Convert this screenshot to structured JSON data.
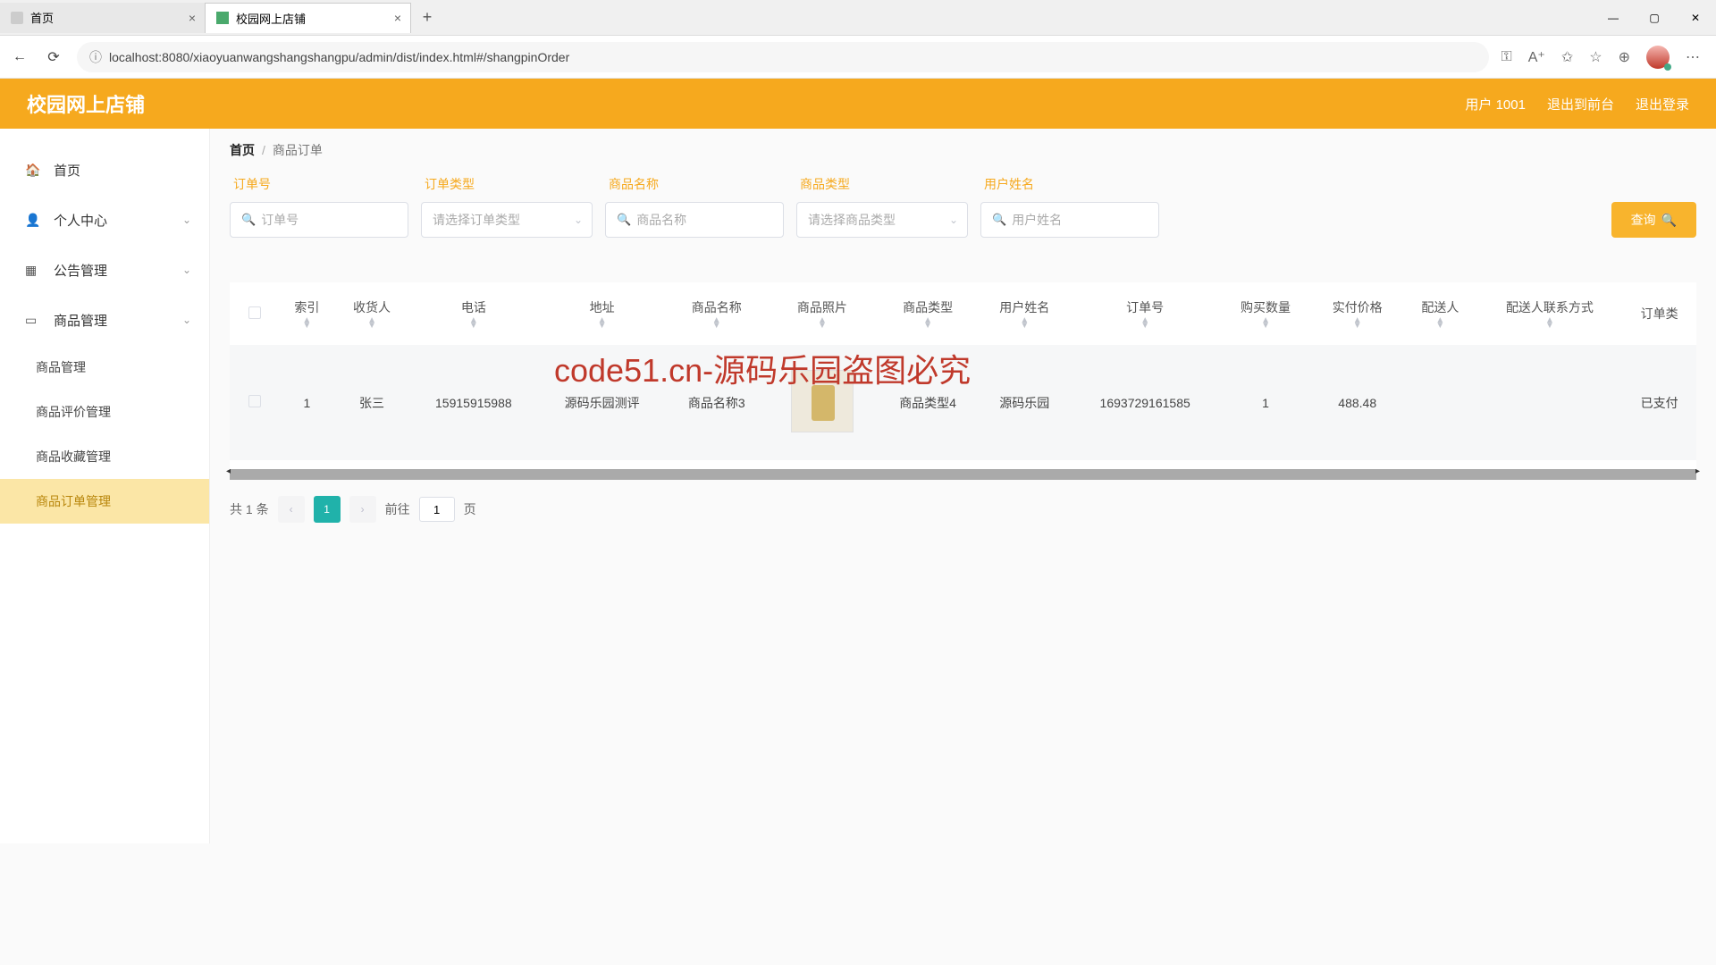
{
  "browser": {
    "tabs": [
      {
        "title": "首页",
        "active": false
      },
      {
        "title": "校园网上店铺",
        "active": true
      }
    ],
    "url": "localhost:8080/xiaoyuanwangshangshangpu/admin/dist/index.html#/shangpinOrder"
  },
  "header": {
    "title": "校园网上店铺",
    "user_label": "用户 1001",
    "front_link": "退出到前台",
    "logout_link": "退出登录"
  },
  "sidebar": {
    "home": "首页",
    "profile": "个人中心",
    "notice": "公告管理",
    "product": "商品管理",
    "subs": {
      "manage": "商品管理",
      "review": "商品评价管理",
      "collect": "商品收藏管理",
      "order": "商品订单管理"
    }
  },
  "breadcrumb": {
    "home": "首页",
    "current": "商品订单"
  },
  "search": {
    "labels": {
      "order_no": "订单号",
      "order_type": "订单类型",
      "product_name": "商品名称",
      "product_type": "商品类型",
      "user_name": "用户姓名"
    },
    "placeholders": {
      "order_no": "订单号",
      "order_type": "请选择订单类型",
      "product_name": "商品名称",
      "product_type": "请选择商品类型",
      "user_name": "用户姓名"
    },
    "btn": "查询"
  },
  "table": {
    "headers": {
      "index": "索引",
      "receiver": "收货人",
      "phone": "电话",
      "address": "地址",
      "product_name": "商品名称",
      "product_photo": "商品照片",
      "product_type": "商品类型",
      "user_name": "用户姓名",
      "order_no": "订单号",
      "qty": "购买数量",
      "price": "实付价格",
      "courier": "配送人",
      "courier_contact": "配送人联系方式",
      "order_type": "订单类"
    },
    "rows": [
      {
        "index": "1",
        "receiver": "张三",
        "phone": "15915915988",
        "address": "源码乐园测评",
        "product_name": "商品名称3",
        "product_type": "商品类型4",
        "user_name": "源码乐园",
        "order_no": "1693729161585",
        "qty": "1",
        "price": "488.48",
        "courier": "",
        "courier_contact": "",
        "order_type": "已支付"
      }
    ]
  },
  "pagination": {
    "total_text": "共 1 条",
    "current": "1",
    "goto_prefix": "前往",
    "goto_suffix": "页",
    "goto_value": "1"
  },
  "watermark_overlay": "code51.cn-源码乐园盗图必究"
}
